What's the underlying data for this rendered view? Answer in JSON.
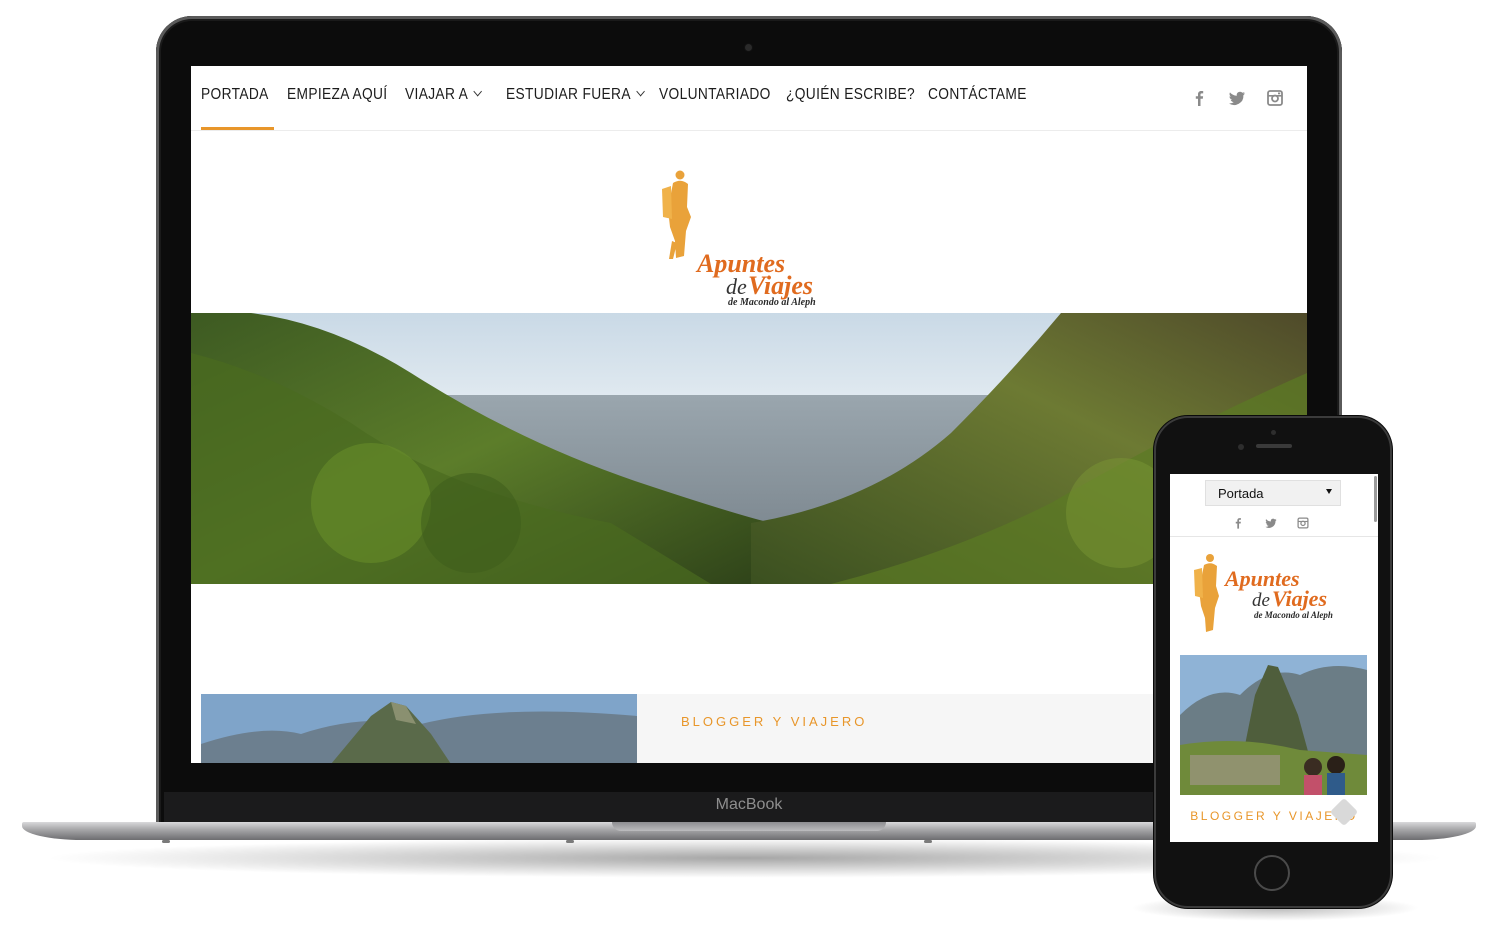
{
  "device": {
    "laptop_brand": "MacBook"
  },
  "desktop": {
    "nav": {
      "items": [
        {
          "label": "PORTADA",
          "active": true,
          "dropdown": false
        },
        {
          "label": "EMPIEZA AQUÍ",
          "active": false,
          "dropdown": false
        },
        {
          "label": "VIAJAR A",
          "active": false,
          "dropdown": true
        },
        {
          "label": "ESTUDIAR FUERA",
          "active": false,
          "dropdown": true
        },
        {
          "label": "VOLUNTARIADO",
          "active": false,
          "dropdown": false
        },
        {
          "label": "¿QUIÉN ESCRIBE?",
          "active": false,
          "dropdown": false
        },
        {
          "label": "CONTÁCTAME",
          "active": false,
          "dropdown": false
        }
      ],
      "social_icons": [
        "facebook-icon",
        "twitter-icon",
        "instagram-icon"
      ]
    },
    "logo": {
      "line1": "Apuntes",
      "line2_prefix": "de",
      "line2": "Viajes",
      "tagline": "de Macondo al Aleph"
    },
    "about": {
      "label": "BLOGGER Y VIAJERO"
    }
  },
  "mobile": {
    "menu_select": {
      "selected": "Portada"
    },
    "social_icons": [
      "facebook-icon",
      "twitter-icon",
      "instagram-icon"
    ],
    "logo": {
      "line1": "Apuntes",
      "line2_prefix": "de",
      "line2": "Viajes",
      "tagline": "de Macondo al Aleph"
    },
    "about": {
      "label": "BLOGGER Y VIAJERO"
    }
  },
  "colors": {
    "accent": "#e8962a",
    "logo_orange": "#e06b1f"
  }
}
